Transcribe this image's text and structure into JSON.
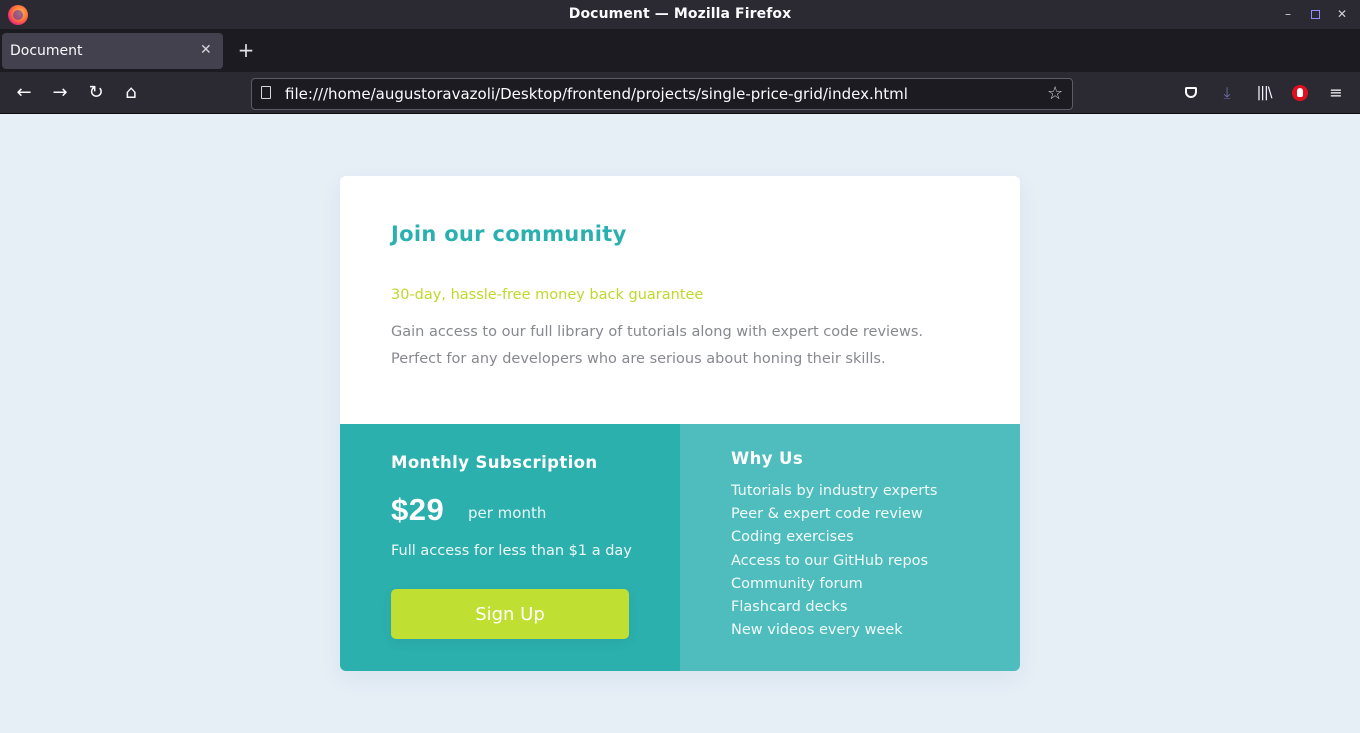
{
  "window": {
    "title": "Document — Mozilla Firefox"
  },
  "tabs": [
    {
      "label": "Document",
      "active": true
    }
  ],
  "navbar": {
    "url": "file:///home/augustoravazoli/Desktop/frontend/projects/single-price-grid/index.html"
  },
  "icons": {
    "app": "firefox-icon",
    "minimize": "minimize-icon",
    "maximize": "maximize-icon",
    "close": "close-icon",
    "tab_close": "close-icon",
    "new_tab": "plus-icon",
    "back": "arrow-left-icon",
    "forward": "arrow-right-icon",
    "reload": "reload-icon",
    "home": "home-icon",
    "page": "page-icon",
    "bookmark": "star-icon",
    "pocket": "pocket-icon",
    "download": "download-icon",
    "library": "library-icon",
    "addon": "ublock-icon",
    "menu": "hamburger-menu-icon"
  },
  "card": {
    "heading": "Join our community",
    "guarantee": "30-day, hassle-free money back guarantee",
    "description": "Gain access to our full library of tutorials along with expert code reviews. Perfect for any developers who are serious about honing their skills.",
    "subscription": {
      "title": "Monthly Subscription",
      "price": "$29",
      "period": "per month",
      "access": "Full access for less than $1 a day",
      "button": "Sign Up"
    },
    "why_us": {
      "title": "Why Us",
      "items": [
        "Tutorials by industry experts",
        "Peer & expert code review",
        "Coding exercises",
        "Access to our GitHub repos",
        "Community forum",
        "Flashcard decks",
        "New videos every week"
      ]
    }
  },
  "colors": {
    "page_background": "#e6eef6",
    "heading": "#2bb0b0",
    "guarantee": "#bfd82c",
    "description": "#87898f",
    "subscription_panel": "#2bb0ae",
    "why_panel": "#4fbdbd",
    "button": "#bfdf32"
  }
}
